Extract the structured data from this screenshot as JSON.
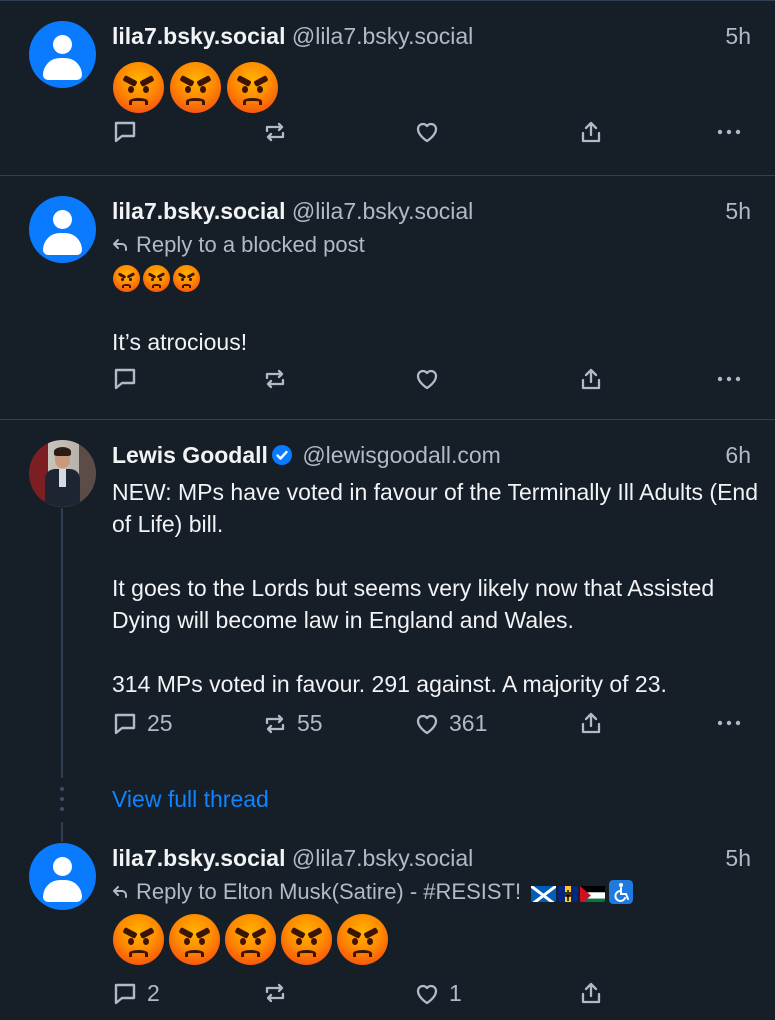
{
  "posts": [
    {
      "name": "lila7.bsky.social",
      "handle": "@lila7.bsky.social",
      "time": "5h",
      "emoji": [
        "angry-face",
        "angry-face",
        "angry-face"
      ]
    },
    {
      "name": "lila7.bsky.social",
      "handle": "@lila7.bsky.social",
      "time": "5h",
      "reply_to": "Reply to a blocked post",
      "emoji": [
        "angry-face",
        "angry-face",
        "angry-face"
      ],
      "text": "It’s atrocious!"
    },
    {
      "name": "Lewis Goodall",
      "handle": "@lewisgoodall.com",
      "time": "6h",
      "verified": true,
      "text": "NEW: MPs have voted in favour of the Terminally Ill Adults (End of Life) bill.\n\nIt goes to the Lords but seems very likely now that Assisted Dying will become law in England and Wales.\n\n314 MPs voted in favour. 291 against. A majority of 23.",
      "replies": "25",
      "reposts": "55",
      "likes": "361",
      "view_thread": "View full thread"
    },
    {
      "name": "lila7.bsky.social",
      "handle": "@lila7.bsky.social",
      "time": "5h",
      "reply_to": "Reply to Elton Musk(Satire) - #RESIST!",
      "reply_flags": [
        "scotland-flag",
        "barbados-flag",
        "palestine-flag",
        "accessibility-symbol"
      ],
      "emoji": [
        "angry-face",
        "angry-face",
        "angry-face",
        "angry-face",
        "angry-face"
      ],
      "replies": "2",
      "likes": "1"
    }
  ],
  "colors": {
    "background": "#161e27",
    "text": "#f1f3f5",
    "muted": "#aebbc9",
    "link": "#1083fe",
    "divider": "#2e4052"
  }
}
